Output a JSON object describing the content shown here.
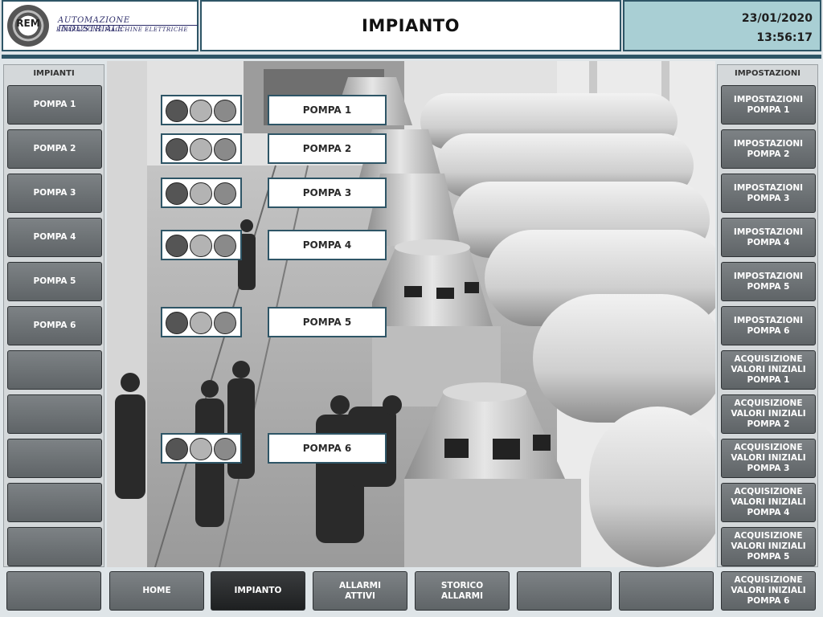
{
  "header": {
    "logo_mark": "REM",
    "logo_line1": "AUTOMAZIONE INDUSTRIALE",
    "logo_line2": "RIPARAZIONE MACCHINE ELETTRICHE",
    "title": "IMPIANTO",
    "date": "23/01/2020",
    "time": "13:56:17"
  },
  "left_panel": {
    "title": "IMPIANTI",
    "items": [
      "POMPA 1",
      "POMPA 2",
      "POMPA 3",
      "POMPA 4",
      "POMPA 5",
      "POMPA 6",
      "",
      "",
      "",
      "",
      ""
    ]
  },
  "right_panel": {
    "title": "IMPOSTAZIONI",
    "items": [
      "IMPOSTAZIONI\nPOMPA 1",
      "IMPOSTAZIONI\nPOMPA 2",
      "IMPOSTAZIONI\nPOMPA 3",
      "IMPOSTAZIONI\nPOMPA 4",
      "IMPOSTAZIONI\nPOMPA 5",
      "IMPOSTAZIONI\nPOMPA 6",
      "ACQUISIZIONE\nVALORI INIZIALI\nPOMPA 1",
      "ACQUISIZIONE\nVALORI INIZIALI\nPOMPA 2",
      "ACQUISIZIONE\nVALORI INIZIALI\nPOMPA 3",
      "ACQUISIZIONE\nVALORI INIZIALI\nPOMPA 4",
      "ACQUISIZIONE\nVALORI INIZIALI\nPOMPA 5",
      "ACQUISIZIONE\nVALORI INIZIALI\nPOMPA 6"
    ]
  },
  "bottom_nav": [
    "",
    "HOME",
    "IMPIANTO",
    "ALLARMI\nATTIVI",
    "STORICO\nALLARMI",
    "",
    ""
  ],
  "bottom_nav_active": "IMPIANTO",
  "pumps": [
    {
      "label": "POMPA 1"
    },
    {
      "label": "POMPA 2"
    },
    {
      "label": "POMPA 3"
    },
    {
      "label": "POMPA 4"
    },
    {
      "label": "POMPA 5"
    },
    {
      "label": "POMPA 6"
    }
  ],
  "colors": {
    "frame": "#2e5566",
    "datetime_bg": "#a9cfd4",
    "button": "#6e7376",
    "button_active": "#2a2c2e",
    "lamp_dark": "#555555",
    "lamp_light": "#b3b3b3",
    "lamp_mid": "#8a8a8a"
  }
}
